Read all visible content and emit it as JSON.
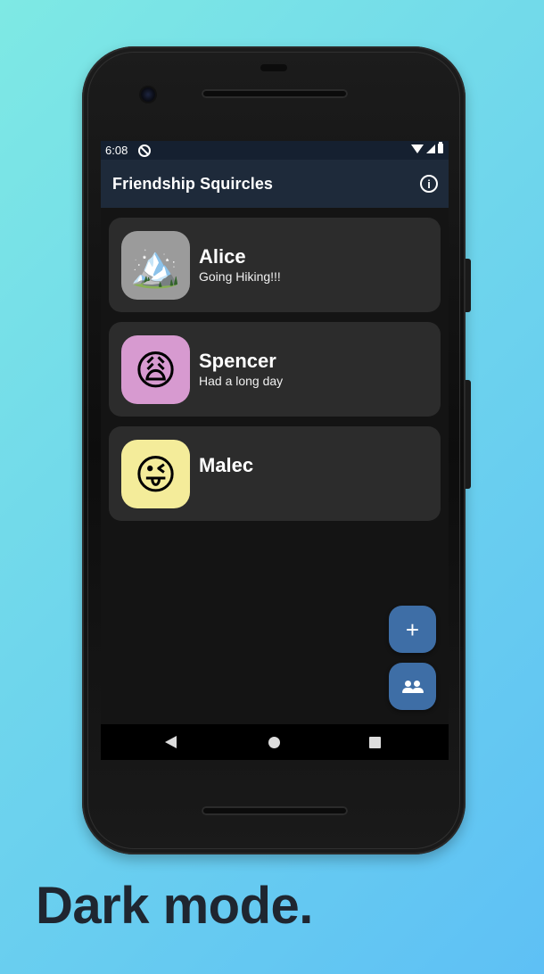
{
  "status_bar": {
    "time": "6:08"
  },
  "app_bar": {
    "title": "Friendship Squircles",
    "info_icon": "info-icon"
  },
  "friends": [
    {
      "name": "Alice",
      "status": "Going Hiking!!!",
      "emoji": "🏔️",
      "avatar_color": "#9b9b9b"
    },
    {
      "name": "Spencer",
      "status": "Had a long day",
      "emoji": "😩",
      "avatar_color": "#d79ad0"
    },
    {
      "name": "Malec",
      "status": "",
      "emoji": "😜",
      "avatar_color": "#f4ec9a"
    }
  ],
  "fab": {
    "add_label": "+",
    "add_icon": "plus-icon",
    "people_icon": "people-icon"
  },
  "nav": {
    "back": "back-icon",
    "home": "home-icon",
    "recents": "recents-icon"
  },
  "caption": "Dark mode.",
  "colors": {
    "app_bar": "#1e2a3a",
    "card": "#2c2c2c",
    "fab": "#3e6ea6",
    "background": "#141414"
  }
}
